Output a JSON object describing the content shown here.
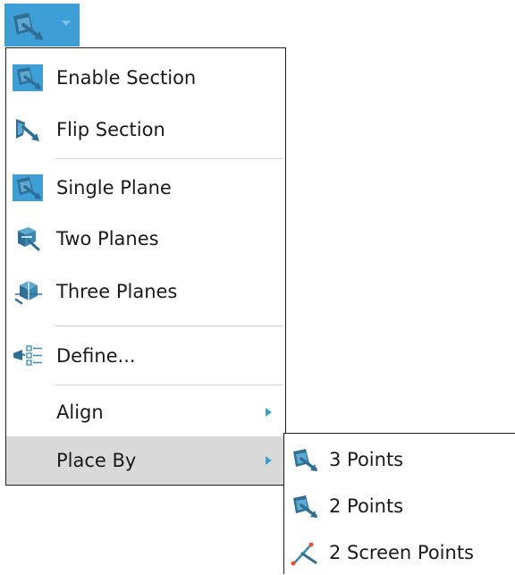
{
  "toolbar": {
    "button_icon": "section-plane-icon",
    "dropdown_icon": "dropdown-arrow-icon",
    "accent_color": "#3d9fd6"
  },
  "menu": {
    "items": [
      {
        "label": "Enable Section",
        "icon": "enable-section-icon"
      },
      {
        "label": "Flip Section",
        "icon": "flip-section-icon"
      },
      {
        "label": "Single Plane",
        "icon": "single-plane-icon"
      },
      {
        "label": "Two Planes",
        "icon": "two-planes-icon"
      },
      {
        "label": "Three Planes",
        "icon": "three-planes-icon"
      },
      {
        "label": "Define...",
        "icon": "define-icon"
      },
      {
        "label": "Align",
        "icon": "submenu-arrow-icon"
      },
      {
        "label": "Place By",
        "icon": "submenu-arrow-icon"
      }
    ],
    "highlighted_item": "Place By",
    "highlight_color": "#d9d9d9"
  },
  "submenu": {
    "items": [
      {
        "label": "3 Points",
        "icon": "three-points-icon"
      },
      {
        "label": "2 Points",
        "icon": "two-points-icon"
      },
      {
        "label": "2 Screen Points",
        "icon": "two-screen-points-icon"
      }
    ]
  }
}
